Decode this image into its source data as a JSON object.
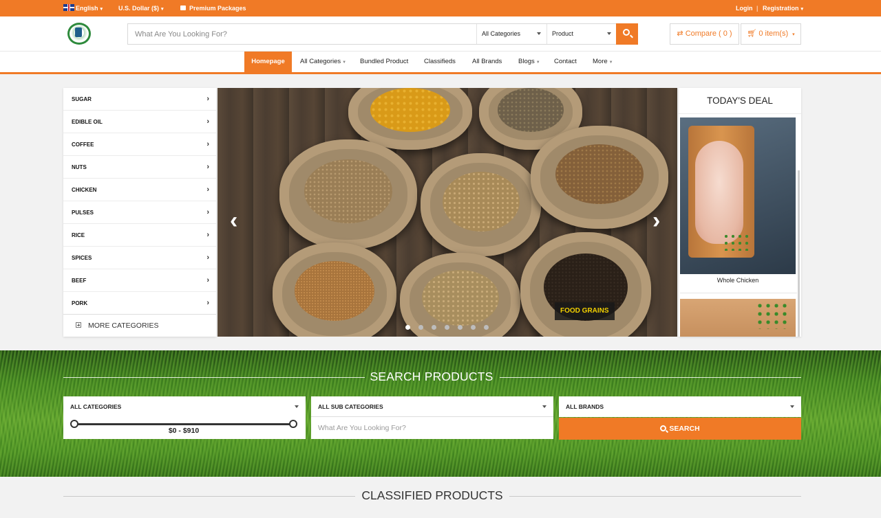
{
  "topbar": {
    "language": "English",
    "currency": "U.S. Dollar ($)",
    "packages": "Premium Packages",
    "login": "Login",
    "separator": "|",
    "registration": "Registration"
  },
  "header": {
    "search_placeholder": "What Are You Looking For?",
    "category_select": "All Categories",
    "type_select": "Product",
    "compare": "Compare ( 0 )",
    "cart": "0 item(s)"
  },
  "nav": {
    "items": [
      "Homepage",
      "All Categories",
      "Bundled Product",
      "Classifieds",
      "All Brands",
      "Blogs",
      "Contact",
      "More"
    ]
  },
  "categories": {
    "items": [
      "SUGAR",
      "EDIBLE OIL",
      "COFFEE",
      "NUTS",
      "CHICKEN",
      "PULSES",
      "RICE",
      "SPICES",
      "BEEF",
      "PORK"
    ],
    "more": "MORE CATEGORIES"
  },
  "slider": {
    "label": "FOOD GRAINS",
    "dot_count": 7,
    "active_dot": 0
  },
  "deal": {
    "title": "TODAY'S DEAL",
    "product_name": "Whole Chicken"
  },
  "search_products": {
    "title": "SEARCH PRODUCTS",
    "category": "ALL CATEGORIES",
    "sub_category": "ALL SUB CATEGORIES",
    "brand": "ALL BRANDS",
    "price_range": "$0 - $910",
    "price_min": 0,
    "price_max": 910,
    "keyword_placeholder": "What Are You Looking For?",
    "button": "SEARCH"
  },
  "classified": {
    "title": "CLASSIFIED PRODUCTS"
  },
  "colors": {
    "accent": "#f07a26",
    "slide_label_text": "#f2d000"
  }
}
